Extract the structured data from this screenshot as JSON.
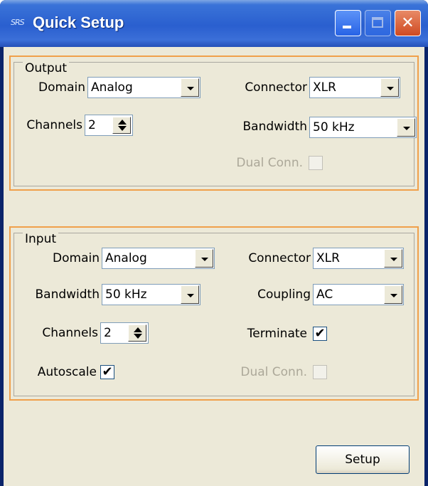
{
  "window": {
    "title": "Quick Setup",
    "icon_text": "SRS"
  },
  "output": {
    "legend": "Output",
    "domain_label": "Domain",
    "domain_value": "Analog",
    "connector_label": "Connector",
    "connector_value": "XLR",
    "channels_label": "Channels",
    "channels_value": "2",
    "bandwidth_label": "Bandwidth",
    "bandwidth_value": "50 kHz",
    "dual_label": "Dual Conn.",
    "dual_checked": false
  },
  "input": {
    "legend": "Input",
    "domain_label": "Domain",
    "domain_value": "Analog",
    "connector_label": "Connector",
    "connector_value": "XLR",
    "bandwidth_label": "Bandwidth",
    "bandwidth_value": "50 kHz",
    "coupling_label": "Coupling",
    "coupling_value": "AC",
    "channels_label": "Channels",
    "channels_value": "2",
    "terminate_label": "Terminate",
    "terminate_checked": true,
    "autoscale_label": "Autoscale",
    "autoscale_checked": true,
    "dual_label": "Dual Conn.",
    "dual_checked": false
  },
  "setup_button": "Setup",
  "colors": {
    "group_border": "#f0a04b",
    "face": "#ece9d8",
    "titlebar": "#2a5fcf"
  },
  "icons": {
    "close": "close-icon",
    "minimize": "minimize-icon",
    "maximize": "maximize-icon",
    "check": "check-icon"
  }
}
